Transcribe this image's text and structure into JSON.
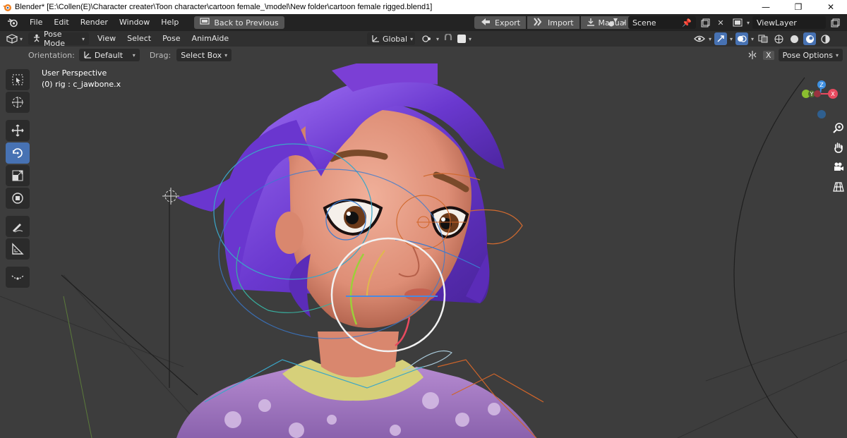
{
  "window": {
    "title": "Blender* [E:\\Collen(E)\\Character creater\\Toon character\\cartoon female_\\model\\New folder\\cartoon female rigged.blend1]",
    "minimize_glyph": "—",
    "maximize_glyph": "❐",
    "close_glyph": "✕"
  },
  "menubar": {
    "items": [
      "File",
      "Edit",
      "Render",
      "Window",
      "Help"
    ],
    "back_button": "Back to Previous",
    "export": "Export",
    "import": "Import",
    "manual": "Manual",
    "scene": "Scene",
    "view_layer": "ViewLayer"
  },
  "viewport_header": {
    "mode": "Pose Mode",
    "menus": [
      "View",
      "Select",
      "Pose",
      "AnimAide"
    ],
    "transform_orientation": "Global"
  },
  "tool_settings": {
    "orientation_label": "Orientation:",
    "orientation_value": "Default",
    "drag_label": "Drag:",
    "drag_value": "Select Box",
    "pose_options": "Pose Options",
    "close_x": "X"
  },
  "overlay": {
    "view_name": "User Perspective",
    "object_info": "(0) rig : c_jawbone.x"
  },
  "gizmo": {
    "x_label": "X",
    "y_label": "Y",
    "z_label": "Z",
    "colors": {
      "x": "#e84a5f",
      "y": "#8bbf2f",
      "z": "#3d8fe0"
    }
  },
  "icons": {
    "toolbar": [
      "select-box-icon",
      "cursor-icon",
      "move-icon",
      "rotate-icon",
      "scale-icon",
      "transform-icon",
      "annotate-icon",
      "measure-icon",
      "relax-icon"
    ],
    "nav": [
      "zoom-icon",
      "pan-hand-icon",
      "camera-icon",
      "grid-icon"
    ]
  },
  "colors": {
    "accent": "#4772b3",
    "hair": "#7a45d8",
    "skin": "#e89a80",
    "shirt": "#a77bc4"
  }
}
